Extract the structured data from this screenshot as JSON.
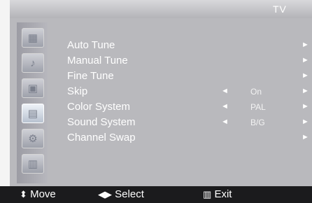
{
  "header": {
    "title": "TV"
  },
  "sidebar": {
    "icons": [
      {
        "name": "picture-icon",
        "glyph": "▦"
      },
      {
        "name": "sound-icon",
        "glyph": "♪"
      },
      {
        "name": "tv-icon",
        "glyph": "▣"
      },
      {
        "name": "channel-icon",
        "glyph": "▤",
        "selected": true
      },
      {
        "name": "setup-icon",
        "glyph": "⚙"
      },
      {
        "name": "feature-icon",
        "glyph": "▥"
      }
    ]
  },
  "menu": {
    "items": [
      {
        "label": "Auto Tune",
        "value": "",
        "has_left": false
      },
      {
        "label": "Manual Tune",
        "value": "",
        "has_left": false
      },
      {
        "label": "Fine Tune",
        "value": "",
        "has_left": false
      },
      {
        "label": "Skip",
        "value": "On",
        "has_left": true
      },
      {
        "label": "Color System",
        "value": "PAL",
        "has_left": true
      },
      {
        "label": "Sound System",
        "value": "B/G",
        "has_left": true
      },
      {
        "label": "Channel Swap",
        "value": "",
        "has_left": false
      }
    ]
  },
  "footer": {
    "move_label": "Move",
    "select_label": "Select",
    "exit_label": "Exit"
  },
  "colors": {
    "panel": "#b9b9bd",
    "bar": "#1b1b1d",
    "text": "#ffffff"
  }
}
